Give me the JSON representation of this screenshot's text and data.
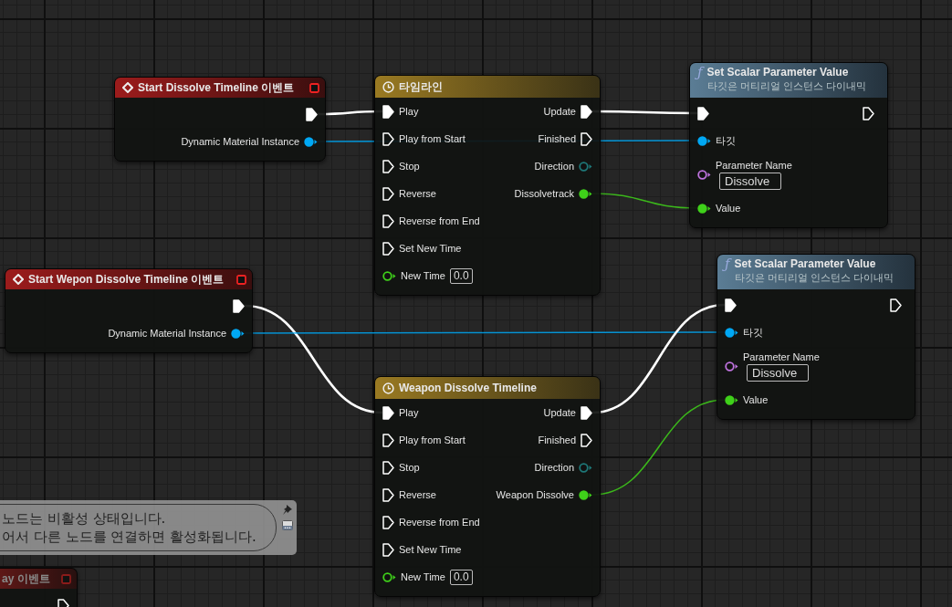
{
  "nodes": [
    {
      "kind": "event",
      "title": "Start Dissolve Timeline 이벤트",
      "clipped": false,
      "outputs": [
        {
          "kind": "exec",
          "connected": true
        },
        {
          "kind": "object",
          "label": "Dynamic Material Instance",
          "connected": true
        }
      ]
    },
    {
      "kind": "timeline",
      "title": "타임라인",
      "clipped": false,
      "inputs": [
        {
          "kind": "exec",
          "label": "Play",
          "connected": true
        },
        {
          "kind": "exec",
          "label": "Play from Start",
          "connected": false
        },
        {
          "kind": "exec",
          "label": "Stop",
          "connected": false
        },
        {
          "kind": "exec",
          "label": "Reverse",
          "connected": false
        },
        {
          "kind": "exec",
          "label": "Reverse from End",
          "connected": false
        },
        {
          "kind": "exec",
          "label": "Set New Time",
          "connected": false
        },
        {
          "kind": "float",
          "label": "New Time",
          "value": "0.0",
          "connected": false
        }
      ],
      "outputs": [
        {
          "kind": "exec",
          "label": "Update",
          "connected": true
        },
        {
          "kind": "exec",
          "label": "Finished",
          "connected": false
        },
        {
          "kind": "direction",
          "label": "Direction",
          "connected": false
        },
        {
          "kind": "float",
          "label": "Dissolvetrack",
          "connected": true
        }
      ]
    },
    {
      "kind": "function",
      "glyph": "ƒ",
      "title": "Set Scalar Parameter Value",
      "subtitle": "타깃은 머티리얼 인스턴스 다이내믹",
      "clipped": false,
      "inputs": [
        {
          "kind": "exec",
          "connected": true
        },
        {
          "kind": "object",
          "label": "타깃",
          "connected": true
        },
        {
          "kind": "name",
          "label": "Parameter Name",
          "value": "Dissolve",
          "connected": false
        },
        {
          "kind": "float",
          "label": "Value",
          "connected": true
        }
      ],
      "outputs": [
        {
          "kind": "exec",
          "connected": false
        }
      ]
    },
    {
      "kind": "event",
      "title": "Start Wepon Dissolve Timeline 이벤트",
      "clipped": false,
      "outputs": [
        {
          "kind": "exec",
          "connected": true
        },
        {
          "kind": "object",
          "label": "Dynamic Material Instance",
          "connected": true
        }
      ]
    },
    {
      "kind": "function",
      "glyph": "ƒ",
      "title": "Set Scalar Parameter Value",
      "subtitle": "타깃은 머티리얼 인스턴스 다이내믹",
      "clipped": false,
      "inputs": [
        {
          "kind": "exec",
          "connected": true
        },
        {
          "kind": "object",
          "label": "타깃",
          "connected": true
        },
        {
          "kind": "name",
          "label": "Parameter Name",
          "value": "Dissolve",
          "connected": false
        },
        {
          "kind": "float",
          "label": "Value",
          "connected": true
        }
      ],
      "outputs": [
        {
          "kind": "exec",
          "connected": false
        }
      ]
    },
    {
      "kind": "event",
      "title": "ay 이벤트",
      "clipped": true,
      "outputs": [
        {
          "kind": "exec",
          "connected": false
        }
      ]
    },
    {
      "kind": "timeline",
      "title": "Weapon Dissolve Timeline",
      "clipped": false,
      "inputs": [
        {
          "kind": "exec",
          "label": "Play",
          "connected": true
        },
        {
          "kind": "exec",
          "label": "Play from Start",
          "connected": false
        },
        {
          "kind": "exec",
          "label": "Stop",
          "connected": false
        },
        {
          "kind": "exec",
          "label": "Reverse",
          "connected": false
        },
        {
          "kind": "exec",
          "label": "Reverse from End",
          "connected": false
        },
        {
          "kind": "exec",
          "label": "Set New Time",
          "connected": false
        },
        {
          "kind": "float",
          "label": "New Time",
          "value": "0.0",
          "connected": false
        }
      ],
      "outputs": [
        {
          "kind": "exec",
          "label": "Update",
          "connected": true
        },
        {
          "kind": "exec",
          "label": "Finished",
          "connected": false
        },
        {
          "kind": "direction",
          "label": "Direction",
          "connected": false
        },
        {
          "kind": "float",
          "label": "Weapon Dissolve",
          "connected": true
        }
      ]
    }
  ],
  "comment_bubble": {
    "lines": [
      "노드는 비활성 상태입니다.",
      "어서 다른 노드를 연결하면 활성화됩니다."
    ]
  }
}
